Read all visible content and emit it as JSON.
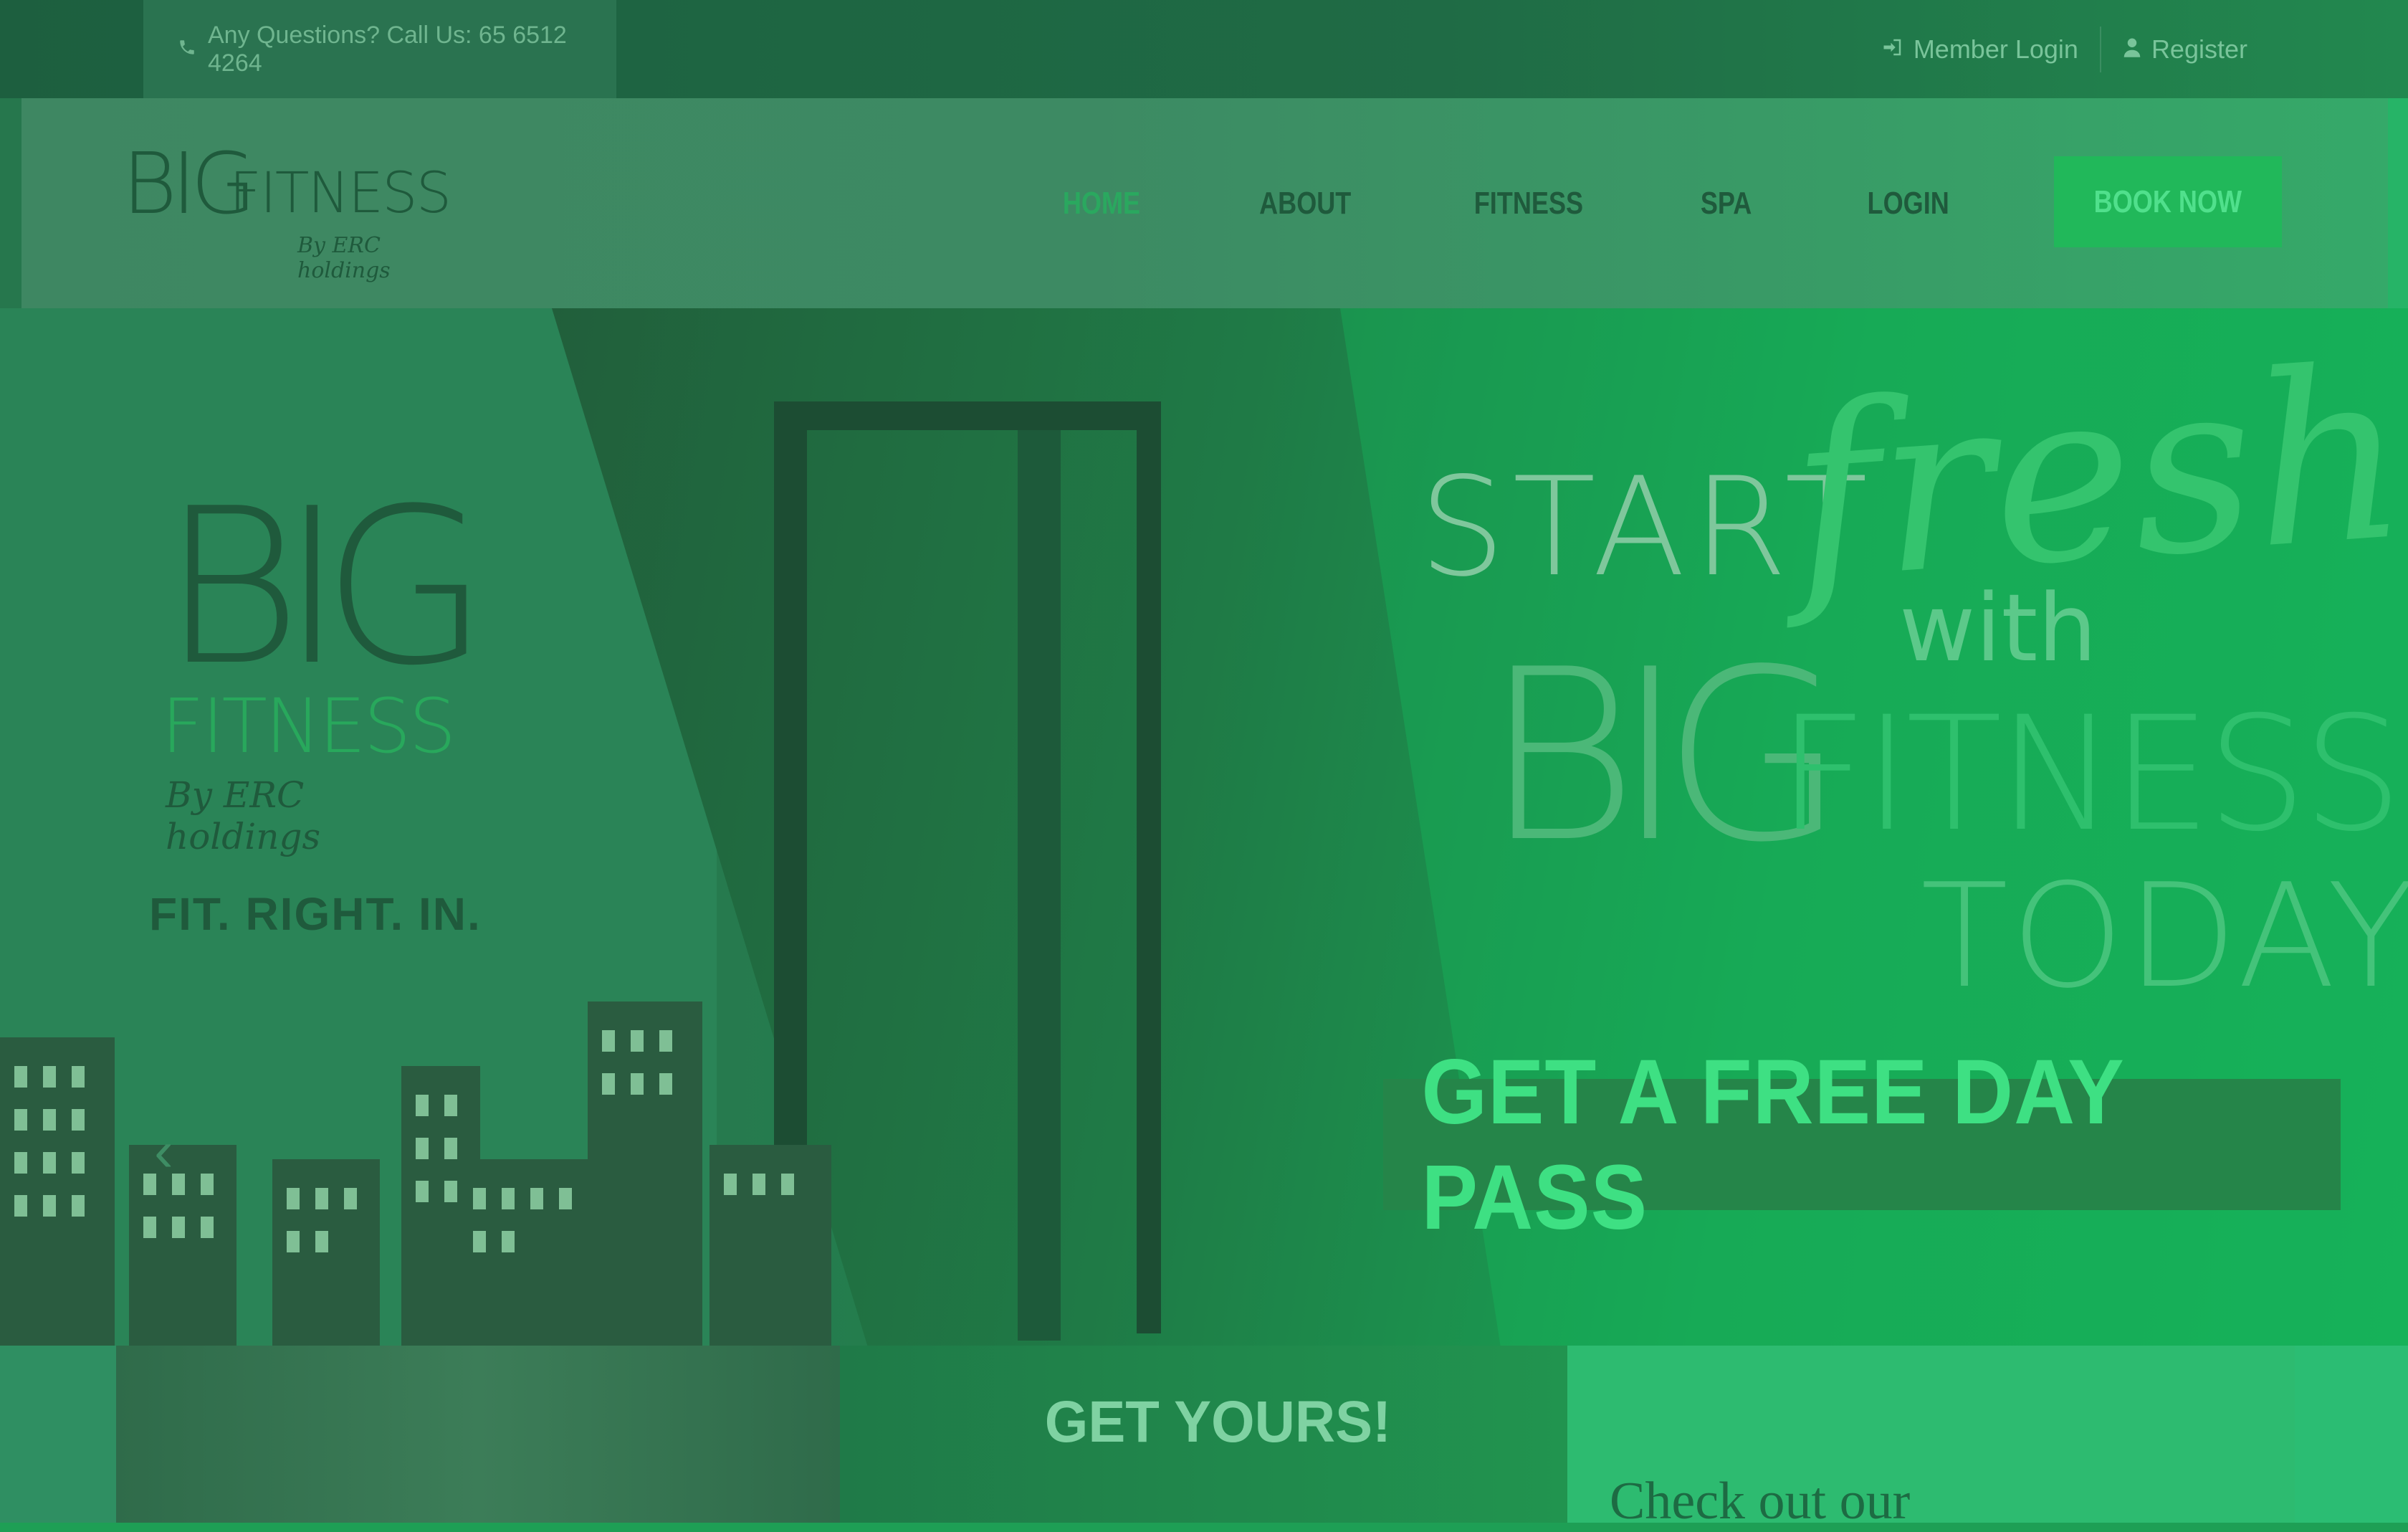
{
  "topbar": {
    "question": "Any Questions? Call Us: 65 6512 4264",
    "member_login": "Member Login",
    "register": "Register"
  },
  "header": {
    "logo": {
      "big": "BIG",
      "fitness": "FITNESS",
      "by": "By ERC holdings"
    },
    "nav": [
      {
        "label": "HOME",
        "active": true
      },
      {
        "label": "ABOUT",
        "active": false
      },
      {
        "label": "FITNESS",
        "active": false
      },
      {
        "label": "SPA",
        "active": false
      },
      {
        "label": "LOGIN",
        "active": false
      }
    ],
    "book_now": "BOOK NOW"
  },
  "hero": {
    "logo": {
      "big": "BIG",
      "fitness": "FITNESS",
      "by": "By ERC holdings"
    },
    "tagline": "FIT. RIGHT. IN.",
    "headline": {
      "start": "START",
      "fresh": "fresh",
      "with": "with",
      "big": "BIG",
      "fitness": "FITNESS",
      "today": "TODAY"
    },
    "cta": "GET A FREE DAY PASS",
    "prev_glyph": "‹",
    "next_glyph": "›"
  },
  "bottom": {
    "get_yours": "GET YOURS!",
    "check_out": "Check out our"
  },
  "icons": {
    "phone": "phone-icon",
    "login": "login-icon",
    "user": "user-icon"
  },
  "colors": {
    "accent": "#24a55a",
    "dark": "#1f5a3c",
    "cta_bg": "#21b85a"
  }
}
